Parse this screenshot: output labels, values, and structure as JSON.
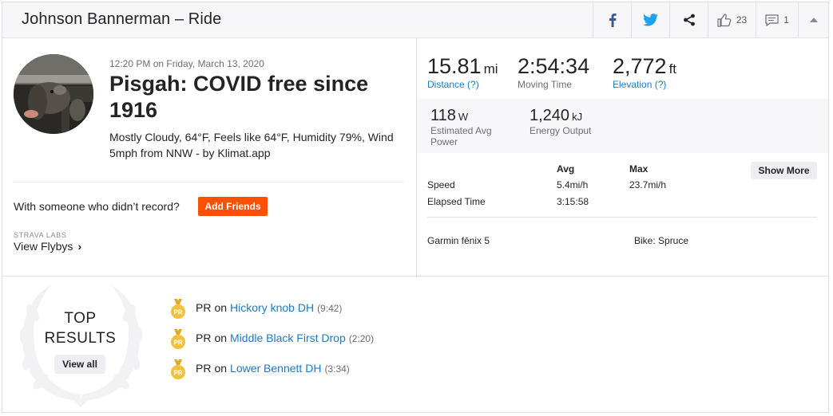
{
  "header": {
    "title": "Johnson Bannerman – Ride",
    "kudos_count": "23",
    "comment_count": "1"
  },
  "activity": {
    "date": "12:20 PM on Friday, March 13, 2020",
    "name": "Pisgah: COVID free since 1916",
    "weather": "Mostly Cloudy, 64°F, Feels like 64°F, Humidity 79%, Wind 5mph from NNW - by Klimat.app",
    "with_someone": "With someone who didn’t record?",
    "add_friends": "Add Friends",
    "labs_label": "STRAVA LABS",
    "flybys": "View Flybys"
  },
  "stats": {
    "distance": {
      "value": "15.81",
      "unit": "mi",
      "label": "Distance (?)"
    },
    "moving_time": {
      "value": "2:54:34",
      "label": "Moving Time"
    },
    "elevation": {
      "value": "2,772",
      "unit": "ft",
      "label": "Elevation (?)"
    },
    "power": {
      "value": "118",
      "unit": "W",
      "label": "Estimated Avg Power"
    },
    "energy": {
      "value": "1,240",
      "unit": "kJ",
      "label": "Energy Output"
    }
  },
  "details": {
    "col_avg": "Avg",
    "col_max": "Max",
    "show_more": "Show More",
    "rows": [
      {
        "label": "Speed",
        "avg": "5.4mi/h",
        "max": "23.7mi/h"
      },
      {
        "label": "Elapsed Time",
        "avg": "3:15:58",
        "max": ""
      }
    ],
    "device": "Garmin fēnix 5",
    "bike": "Bike: Spruce"
  },
  "top_results": {
    "title_line1": "TOP",
    "title_line2": "RESULTS",
    "view_all": "View all",
    "items": [
      {
        "badge": "PR",
        "prefix": "PR",
        "on": "on",
        "segment": "Hickory knob DH",
        "time": "(9:42)"
      },
      {
        "badge": "PR",
        "prefix": "PR",
        "on": "on",
        "segment": "Middle Black First Drop",
        "time": "(2:20)"
      },
      {
        "badge": "PR",
        "prefix": "PR",
        "on": "on",
        "segment": "Lower Bennett DH",
        "time": "(3:34)"
      }
    ]
  },
  "colors": {
    "accent": "#fc5200",
    "link": "#1e7bbf",
    "medal": "#f0c23b",
    "header_bg": "#f7f7fa"
  },
  "icons": [
    "facebook-icon",
    "twitter-icon",
    "share-icon",
    "kudos-thumb-icon",
    "comment-icon",
    "collapse-caret-icon",
    "pr-medal-icon",
    "laurel-wreath-icon",
    "chevron-right-icon"
  ]
}
